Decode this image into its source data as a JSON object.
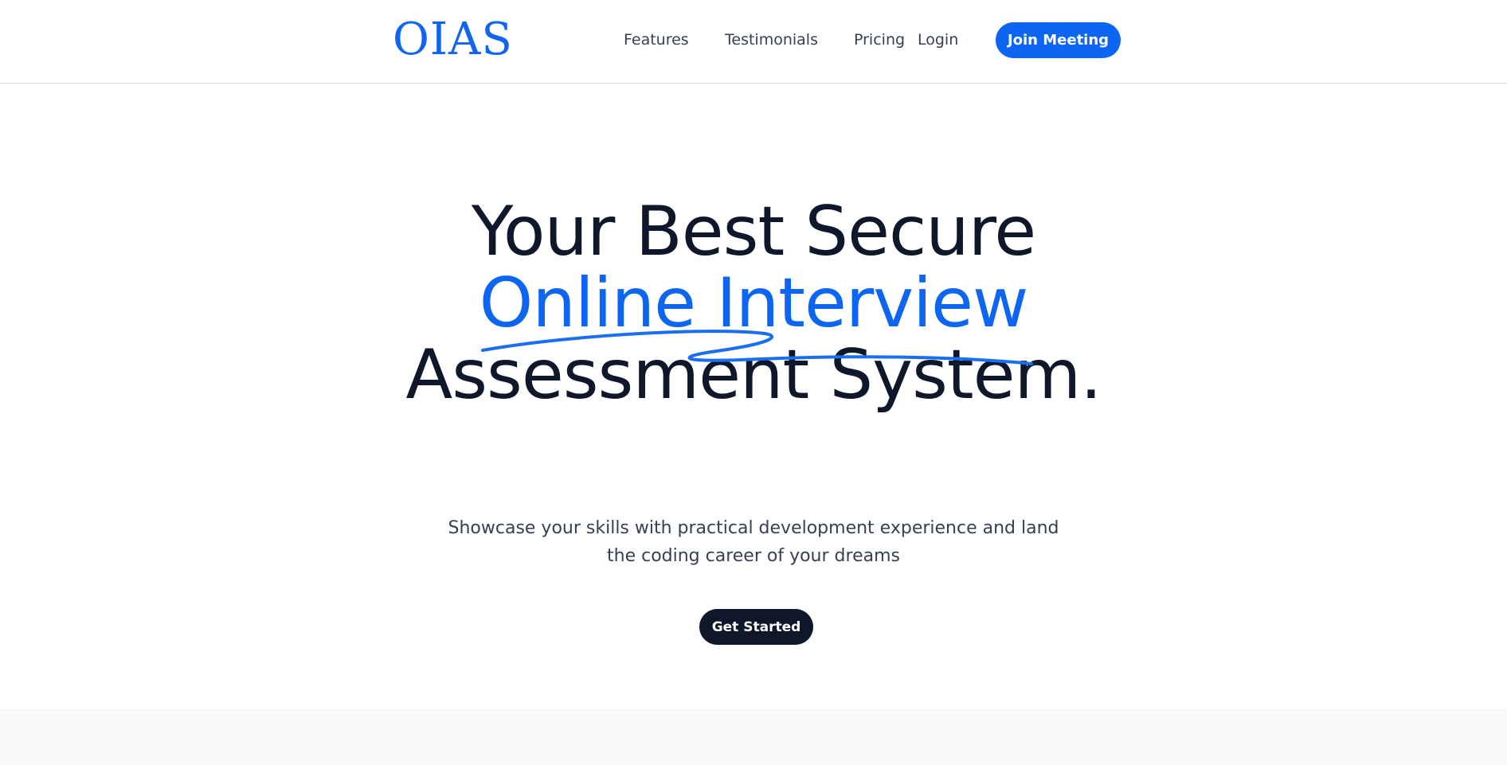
{
  "header": {
    "logo": "OIAS",
    "nav": {
      "features": "Features",
      "testimonials": "Testimonials",
      "pricing": "Pricing",
      "login": "Login"
    },
    "join_button": "Join Meeting"
  },
  "hero": {
    "line1": "Your Best Secure",
    "line2": "Online Interview",
    "line3": "Assessment System.",
    "subtitle": "Showcase your skills with practical development experience and land the coding career of your dreams",
    "cta": "Get Started"
  },
  "colors": {
    "accent": "#0d66f2",
    "dark": "#0f172a",
    "text_muted": "#334155",
    "band_bg": "#f8f9fb"
  }
}
